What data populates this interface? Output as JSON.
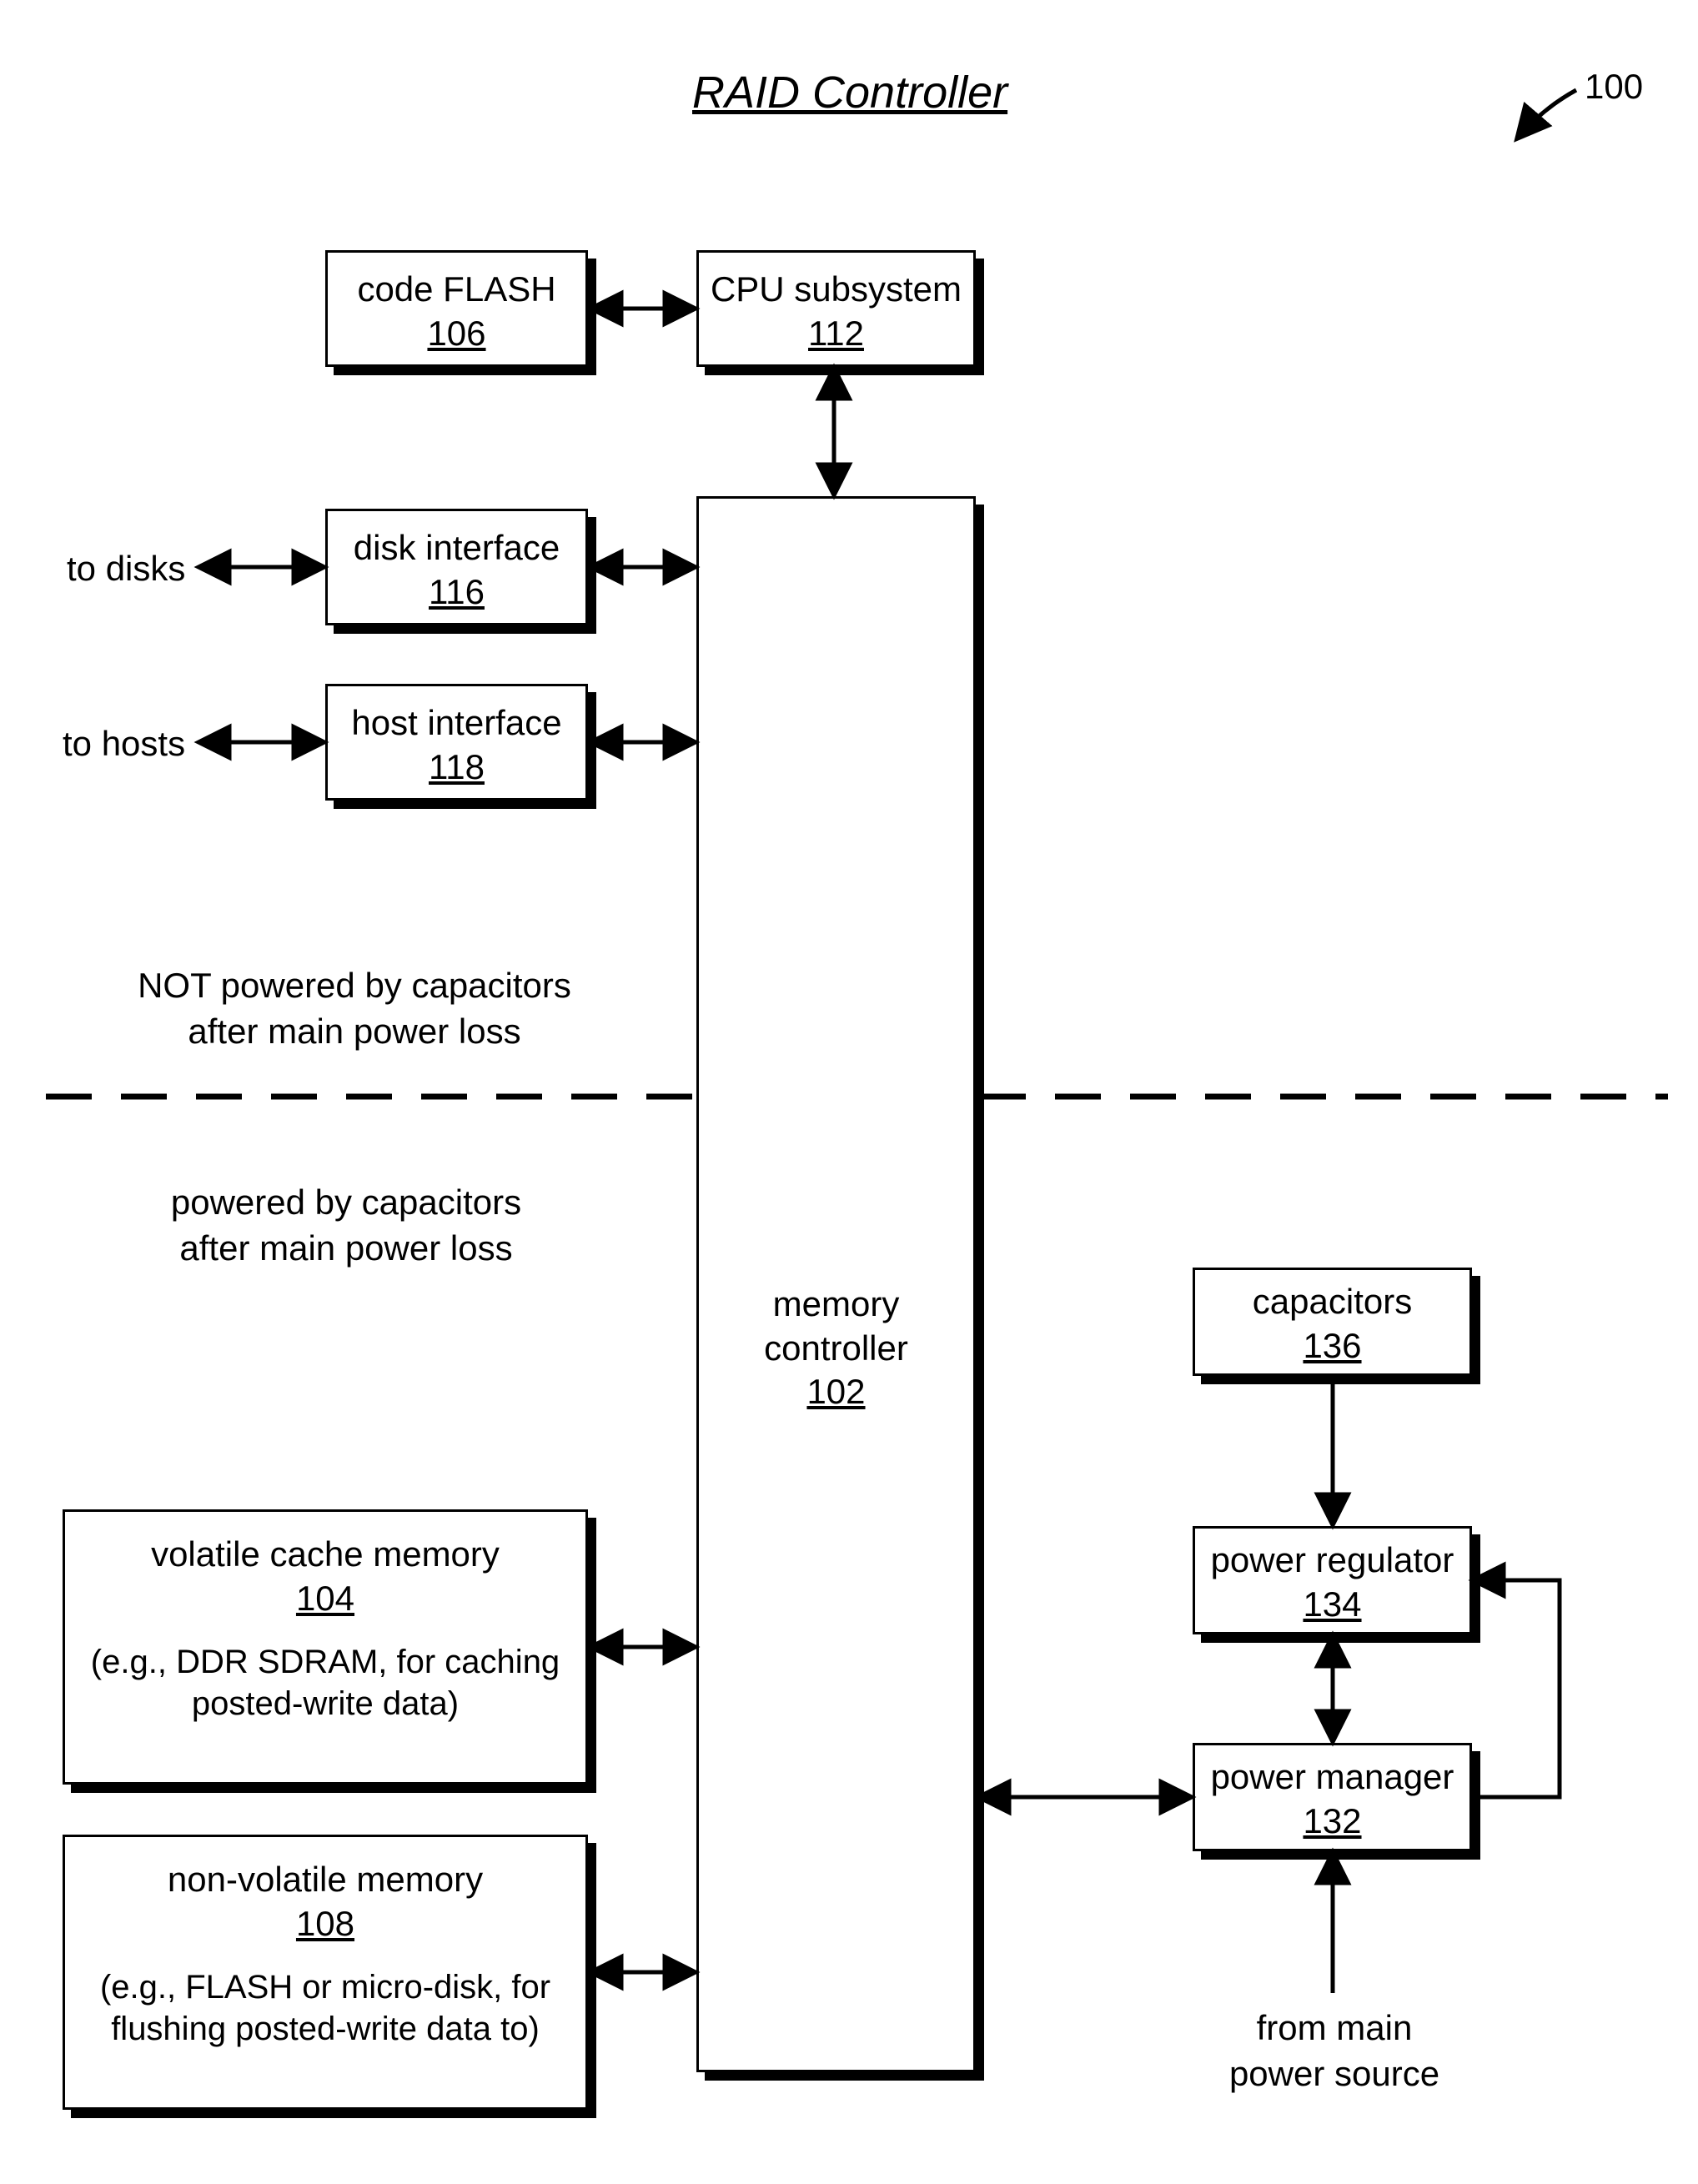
{
  "title": "RAID Controller",
  "refnum": "100",
  "boxes": {
    "code_flash": {
      "label": "code FLASH",
      "num": "106"
    },
    "cpu_subsystem": {
      "label": "CPU subsystem",
      "num": "112"
    },
    "disk_interface": {
      "label": "disk interface",
      "num": "116"
    },
    "host_interface": {
      "label": "host interface",
      "num": "118"
    },
    "memory_controller": {
      "label": "memory controller",
      "num": "102"
    },
    "volatile_cache": {
      "label": "volatile cache memory",
      "num": "104",
      "note": "(e.g., DDR SDRAM, for caching posted-write data)"
    },
    "nonvolatile_mem": {
      "label": "non-volatile memory",
      "num": "108",
      "note": "(e.g., FLASH or micro-disk, for flushing posted-write data to)"
    },
    "capacitors": {
      "label": "capacitors",
      "num": "136"
    },
    "power_regulator": {
      "label": "power regulator",
      "num": "134"
    },
    "power_manager": {
      "label": "power manager",
      "num": "132"
    }
  },
  "labels": {
    "to_disks": "to disks",
    "to_hosts": "to hosts",
    "not_powered": "NOT powered by capacitors\nafter main power loss",
    "powered": "powered by capacitors\nafter main power loss",
    "from_main": "from main\npower source"
  }
}
